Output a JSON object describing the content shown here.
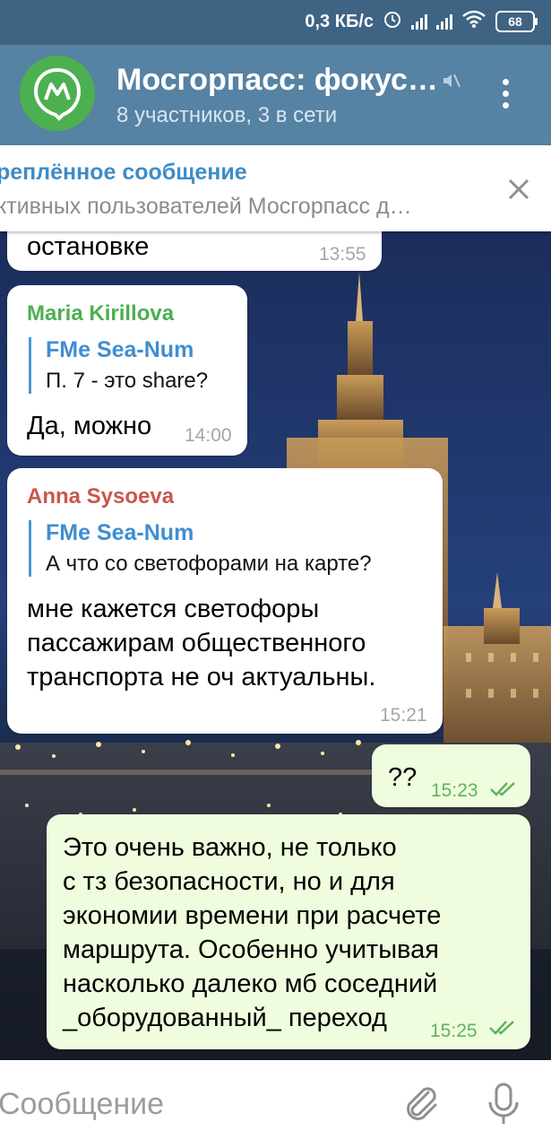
{
  "status_bar": {
    "speed": "0,3 КБ/с",
    "battery": "68"
  },
  "header": {
    "title": "Мосгорпасс: фокус…",
    "subtitle": "8 участников, 3 в сети"
  },
  "pinned": {
    "title": "реплённое сообщение",
    "text": "ктивных пользователей Мосгорпасс д…"
  },
  "messages": [
    {
      "text": "остановке",
      "time": "13:55"
    },
    {
      "sender": "Maria Kirillova",
      "reply_name": "FMe Sea-Num",
      "reply_text": "П. 7 - это share?",
      "text": "Да, можно",
      "time": "14:00"
    },
    {
      "sender": "Anna Sysoeva",
      "reply_name": "FMe Sea-Num",
      "reply_text": "А что со светофорами на карте?",
      "lines": [
        "мне кажется светофоры",
        "пассажирам общественного",
        "транспорта не оч актуальны."
      ],
      "time": "15:21"
    },
    {
      "text": "??",
      "time": "15:23"
    },
    {
      "lines": [
        "Это очень важно, не только",
        "с тз безопасности, но и для",
        "экономии времени при расчете",
        "маршрута. Особенно учитывая",
        "насколько далеко мб соседний",
        "_оборудованный_ переход"
      ],
      "time": "15:25"
    }
  ],
  "input": {
    "placeholder": "Сообщение"
  },
  "colors": {
    "header": "#5682a3",
    "status_bar": "#3f6383",
    "outgoing": "#effdde",
    "maria": "#4caf50",
    "anna": "#c9574c",
    "link": "#3e8cc7"
  }
}
